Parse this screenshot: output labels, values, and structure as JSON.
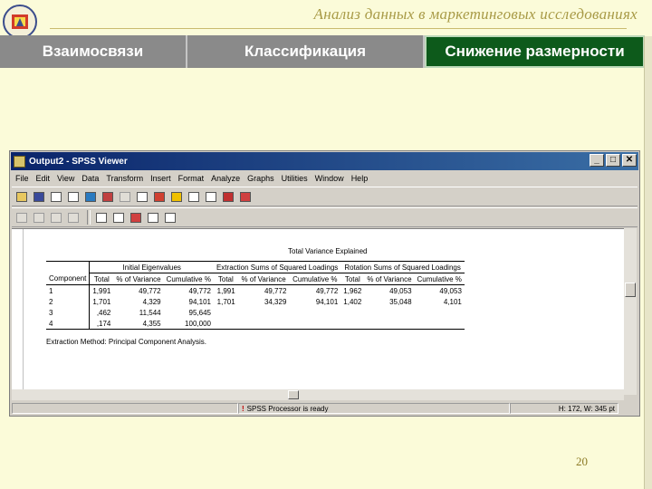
{
  "slide": {
    "title": "Анализ данных в маркетинговых исследованиях",
    "page_number": "20",
    "tabs": [
      {
        "label": "Взаимосвязи"
      },
      {
        "label": "Классификация"
      },
      {
        "label": "Снижение размерности"
      }
    ]
  },
  "window": {
    "title": "Output2 - SPSS Viewer",
    "minimize": "_",
    "maximize": "□",
    "close": "✕",
    "menu": [
      "File",
      "Edit",
      "View",
      "Data",
      "Transform",
      "Insert",
      "Format",
      "Analyze",
      "Graphs",
      "Utilities",
      "Window",
      "Help"
    ]
  },
  "output": {
    "table_title": "Total Variance Explained",
    "group_headers": {
      "component": "Component",
      "initial": "Initial Eigenvalues",
      "extraction": "Extraction Sums of Squared Loadings",
      "rotation": "Rotation Sums of Squared Loadings"
    },
    "columns": [
      "Total",
      "% of Variance",
      "Cumulative %",
      "Total",
      "% of Variance",
      "Cumulative %",
      "Total",
      "% of Variance",
      "Cumulative %"
    ],
    "rows": [
      {
        "component": "1",
        "values": [
          "1,991",
          "49,772",
          "49,772",
          "1,991",
          "49,772",
          "49,772",
          "1,962",
          "49,053",
          "49,053"
        ]
      },
      {
        "component": "2",
        "values": [
          "1,701",
          "4,329",
          "94,101",
          "1,701",
          "34,329",
          "94,101",
          "1,402",
          "35,048",
          "4,101"
        ]
      },
      {
        "component": "3",
        "values": ",462",
        "values_list": [
          ",462",
          "11,544",
          "95,645",
          "",
          "",
          "",
          "",
          "",
          ""
        ]
      },
      {
        "component": "4",
        "values_list": [
          ",174",
          "4,355",
          "100,000",
          "",
          "",
          "",
          "",
          "",
          ""
        ]
      }
    ],
    "footnote": "Extraction Method: Principal Component Analysis."
  },
  "status": {
    "processor": "SPSS Processor  is ready",
    "dimensions": "H: 172, W: 345 pt"
  }
}
